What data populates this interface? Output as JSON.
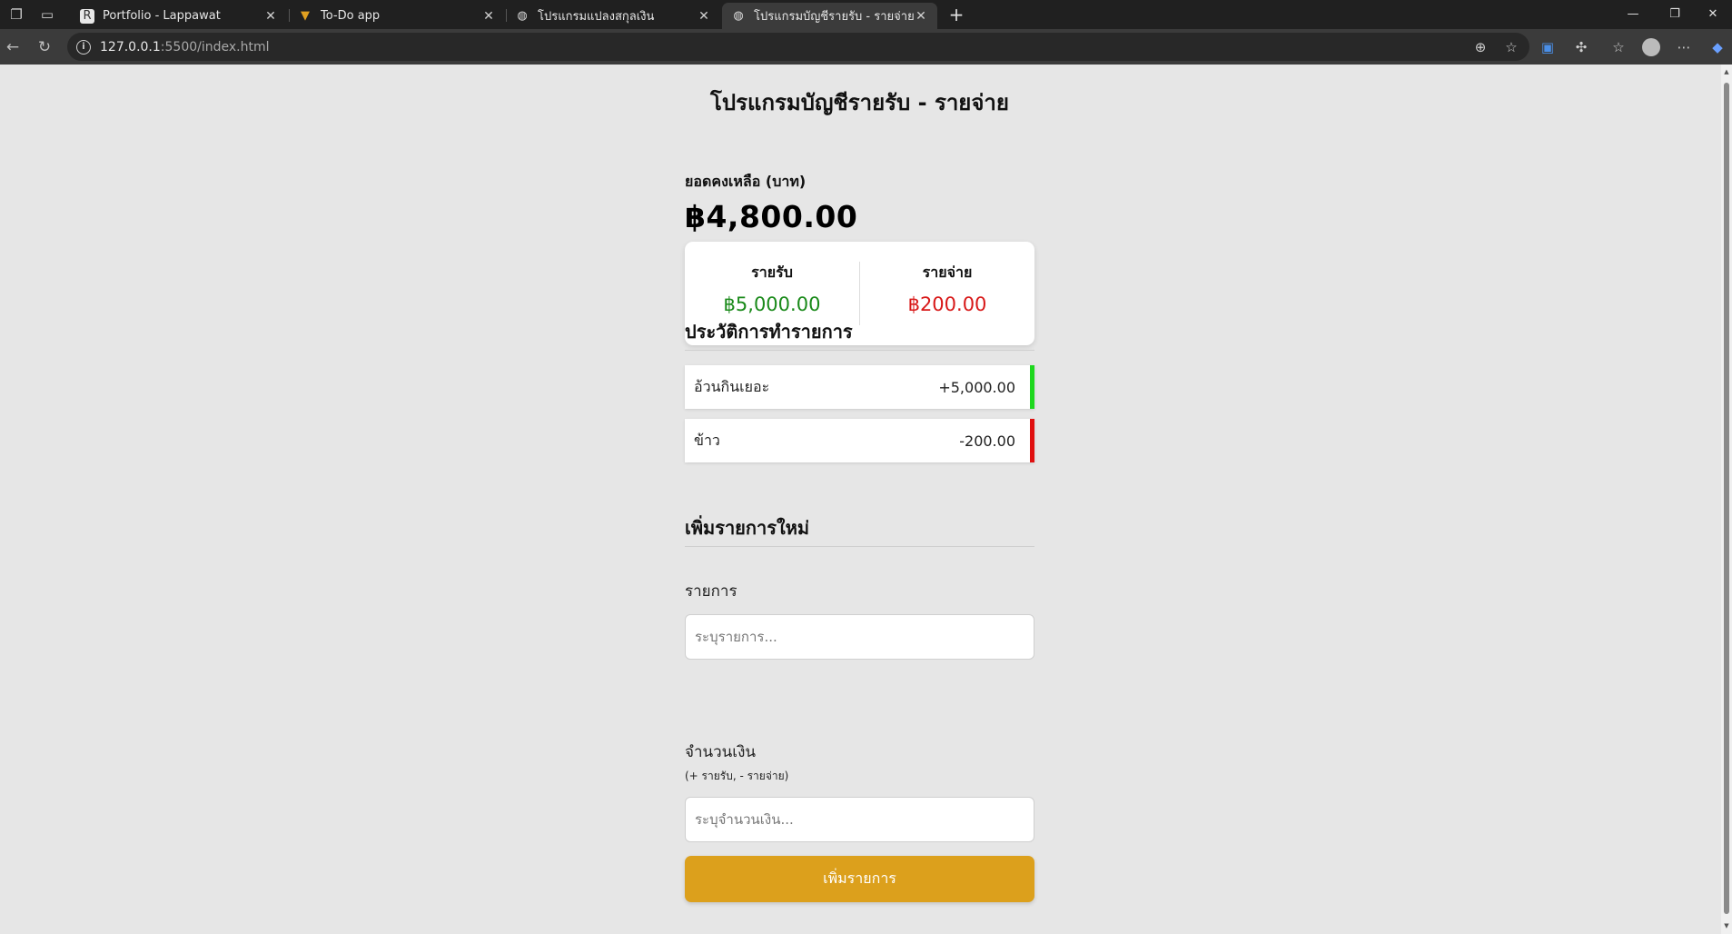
{
  "browser": {
    "tabs": [
      {
        "title": "Portfolio - Lappawat",
        "active": false
      },
      {
        "title": "To-Do app",
        "active": false
      },
      {
        "title": "โปรแกรมแปลงสกุลเงิน",
        "active": false
      },
      {
        "title": "โปรแกรมบัญชีรายรับ - รายจ่าย",
        "active": true
      }
    ],
    "url_host": "127.0.0.1",
    "url_rest": ":5500/index.html"
  },
  "page": {
    "title": "โปรแกรมบัญชีรายรับ - รายจ่าย",
    "balance_label": "ยอดคงเหลือ (บาท)",
    "balance_value": "฿4,800.00",
    "income_label": "รายรับ",
    "income_value": "฿5,000.00",
    "expense_label": "รายจ่าย",
    "expense_value": "฿200.00",
    "income_color": "#1a8a1a",
    "expense_color": "#d81818"
  },
  "history": {
    "title": "ประวัติการทำรายการ",
    "items": [
      {
        "name": "อ้วนกินเยอะ",
        "amount": "+5,000.00",
        "type": "income"
      },
      {
        "name": "ข้าว",
        "amount": "-200.00",
        "type": "expense"
      }
    ]
  },
  "form": {
    "title": "เพิ่มรายการใหม่",
    "text_label": "รายการ",
    "text_placeholder": "ระบุรายการ...",
    "amount_label": "จำนวนเงิน",
    "amount_hint": "(+ รายรับ, - รายจ่าย)",
    "amount_placeholder": "ระบุจำนวนเงิน...",
    "submit_label": "เพิ่มรายการ",
    "button_color": "#dca01c"
  }
}
